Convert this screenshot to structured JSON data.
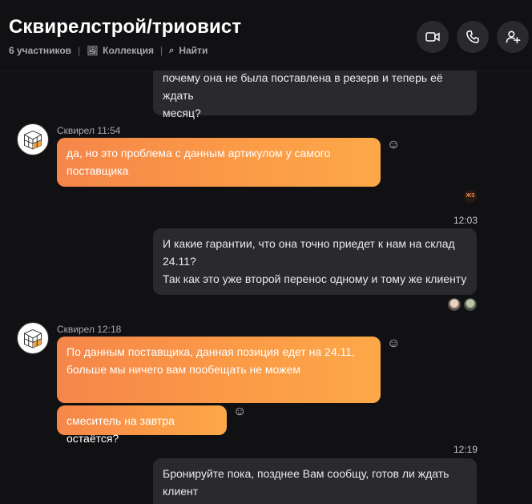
{
  "header": {
    "title": "Сквирелстрой/триовист",
    "participants": "6 участников",
    "collection": "Коллекция",
    "find": "Найти",
    "video_icon": "video-call-icon",
    "call_icon": "phone-icon",
    "add_icon": "add-person-icon"
  },
  "messages": {
    "m1": {
      "text1": "почему она не была поставлена в резерв и теперь её ждать",
      "text2": "месяц?"
    },
    "m2": {
      "author": "Сквирел 11:54",
      "text1": "да, но это проблема с данным артикулом у самого",
      "text2": "поставщика",
      "reader": "ЖЗ"
    },
    "m3": {
      "time": "12:03",
      "text1": "И какие гарантии, что она точно приедет к нам на склад",
      "text2": "24.11?",
      "text3": "Так как это уже второй перенос одному и тому же клиенту"
    },
    "m4": {
      "author": "Сквирел 12:18",
      "text1": "По данным поставщика, данная позиция едет на 24.11,",
      "text2": "больше мы ничего вам пообещать не можем"
    },
    "m5": {
      "text": "смеситель на завтра остаётся?"
    },
    "m6": {
      "time": "12:19",
      "text1": "Бронируйте пока, позднее Вам сообщу, готов ли ждать",
      "text2": "клиент"
    }
  },
  "colors": {
    "background": "#111113",
    "outgoing": "#2a2a2e",
    "incoming_start": "#f5864a",
    "incoming_end": "#fda848"
  }
}
